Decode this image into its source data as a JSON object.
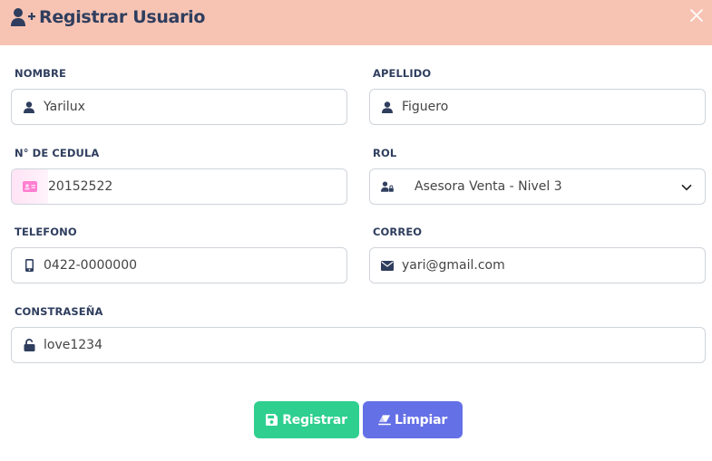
{
  "header": {
    "title": "Registrar Usuario",
    "title_icon": "user-plus-icon",
    "close_icon": "close-icon",
    "background_color": "#f7c4b4"
  },
  "form": {
    "nombre": {
      "label": "NOMBRE",
      "value": "Yarilux",
      "icon": "user-icon"
    },
    "apellido": {
      "label": "APELLIDO",
      "value": "Figuero",
      "icon": "user-icon"
    },
    "cedula": {
      "label": "N° DE CEDULA",
      "value": "20152522",
      "icon": "id-card-icon"
    },
    "rol": {
      "label": "ROL",
      "value": "Asesora Venta - Nivel 3",
      "icon": "user-lock-icon"
    },
    "telefono": {
      "label": "TELEFONO",
      "value": "0422-0000000",
      "icon": "mobile-icon"
    },
    "correo": {
      "label": "CORREO",
      "value": "yari@gmail.com",
      "icon": "envelope-icon"
    },
    "contrasena": {
      "label": "CONSTRASEÑA",
      "value": "love1234",
      "icon": "unlock-icon"
    }
  },
  "buttons": {
    "register": {
      "label": "Registrar",
      "icon": "save-icon",
      "color": "#2ecf8f"
    },
    "clear": {
      "label": "Limpiar",
      "icon": "eraser-icon",
      "color": "#6470e6"
    }
  },
  "colors": {
    "label_text": "#2f3e5e",
    "field_border": "#cfd4da"
  }
}
